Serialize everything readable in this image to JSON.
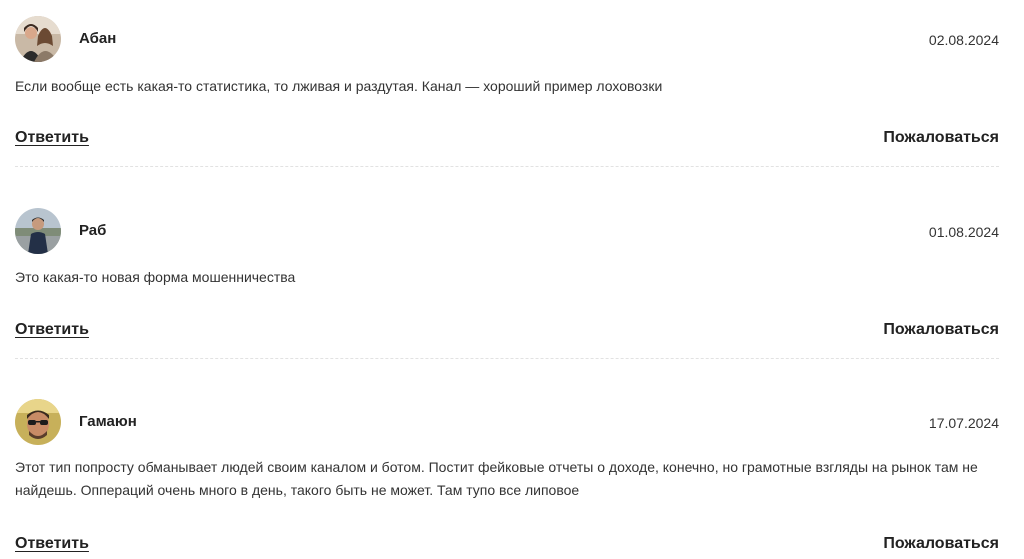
{
  "comments": [
    {
      "author": "Абан",
      "date": "02.08.2024",
      "text": "Если вообще есть какая-то статистика, то лживая и раздутая. Канал — хороший пример лоховозки",
      "reply_label": "Ответить",
      "report_label": "Пожаловаться",
      "avatar": "user-avatar-photo"
    },
    {
      "author": "Раб",
      "date": "01.08.2024",
      "text": "Это какая-то новая форма мошенничества",
      "reply_label": "Ответить",
      "report_label": "Пожаловаться",
      "avatar": "user-avatar-photo"
    },
    {
      "author": "Гамаюн",
      "date": "17.07.2024",
      "text": "Этот тип попросту обманывает людей своим каналом и ботом. Постит фейковые отчеты о доходе, конечно, но грамотные взгляды на рынок там не найдешь. Оппераций очень много в день, такого быть не может. Там тупо все липовое",
      "reply_label": "Ответить",
      "report_label": "Пожаловаться",
      "avatar": "user-avatar-photo"
    }
  ]
}
